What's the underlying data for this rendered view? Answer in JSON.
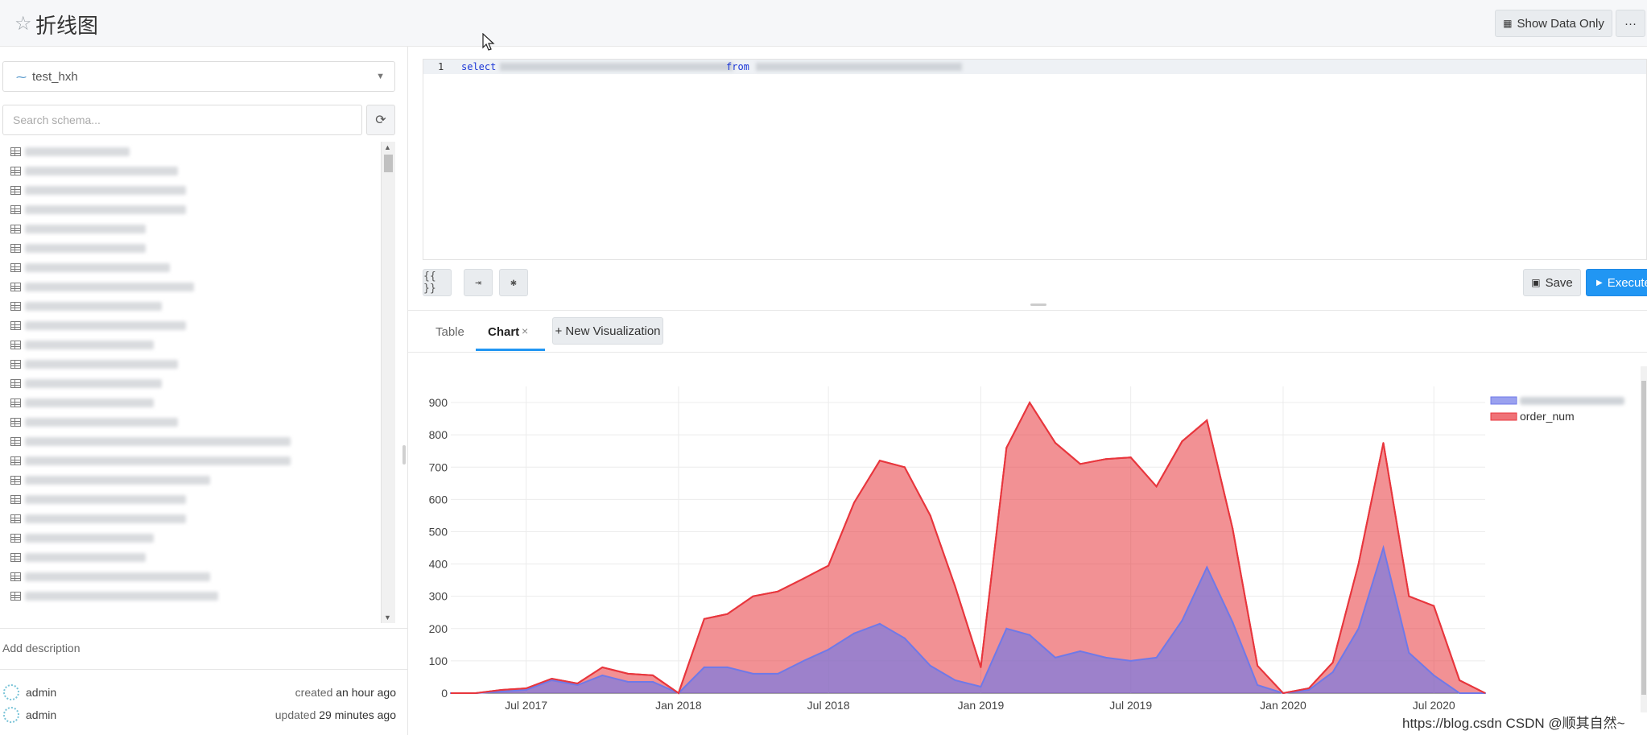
{
  "header": {
    "title": "折线图",
    "show_data_only": "Show Data Only",
    "more": "···"
  },
  "left": {
    "datasource": "test_hxh",
    "search_placeholder": "Search schema...",
    "table_count": 25,
    "add_description": "Add description",
    "created": {
      "user": "admin",
      "prefix": "created",
      "when": "an hour ago"
    },
    "updated": {
      "user": "admin",
      "prefix": "updated",
      "when": "29 minutes ago"
    }
  },
  "editor": {
    "line_number": "1",
    "kw_select": "select",
    "kw_from": "from"
  },
  "toolbar": {
    "format_label": "{{ }}",
    "save": "Save",
    "execute": "Execute"
  },
  "tabs": {
    "table": "Table",
    "chart": "Chart",
    "close": "×",
    "new_viz": "+ New Visualization"
  },
  "watermark": "https://blog.csdn CSDN @顺其自然~",
  "colors": {
    "primary": "#2196f3",
    "series_red": "#e8363d",
    "series_blue": "#6f79e8"
  },
  "chart_data": {
    "type": "area",
    "x": [
      "2017-04",
      "2017-05",
      "2017-06",
      "2017-07",
      "2017-08",
      "2017-09",
      "2017-10",
      "2017-11",
      "2017-12",
      "2018-01",
      "2018-02",
      "2018-03",
      "2018-04",
      "2018-05",
      "2018-06",
      "2018-07",
      "2018-08",
      "2018-09",
      "2018-10",
      "2018-11",
      "2018-12",
      "2019-01",
      "2019-02",
      "2019-03",
      "2019-04",
      "2019-05",
      "2019-06",
      "2019-07",
      "2019-08",
      "2019-09",
      "2019-10",
      "2019-11",
      "2019-12",
      "2020-01",
      "2020-02",
      "2020-03",
      "2020-04",
      "2020-05",
      "2020-06",
      "2020-07",
      "2020-08",
      "2020-09"
    ],
    "x_ticks": [
      "Jul 2017",
      "Jan 2018",
      "Jul 2018",
      "Jan 2019",
      "Jul 2019",
      "Jan 2020",
      "Jul 2020"
    ],
    "ylim": [
      0,
      950
    ],
    "y_ticks": [
      0,
      100,
      200,
      300,
      400,
      500,
      600,
      700,
      800,
      900
    ],
    "grid": true,
    "legend_position": "top-right",
    "series": [
      {
        "name": "",
        "color": "#6f79e8",
        "values": [
          0,
          0,
          5,
          10,
          40,
          25,
          55,
          35,
          35,
          0,
          80,
          80,
          60,
          60,
          100,
          135,
          185,
          215,
          170,
          85,
          40,
          20,
          200,
          180,
          110,
          130,
          110,
          100,
          110,
          225,
          390,
          220,
          25,
          0,
          10,
          65,
          200,
          450,
          125,
          55,
          0,
          0
        ]
      },
      {
        "name": "order_num",
        "color": "#e8363d",
        "values": [
          0,
          0,
          10,
          15,
          45,
          30,
          80,
          60,
          55,
          0,
          230,
          245,
          300,
          315,
          355,
          395,
          590,
          720,
          700,
          550,
          330,
          80,
          760,
          900,
          775,
          710,
          725,
          730,
          640,
          780,
          845,
          510,
          85,
          0,
          15,
          95,
          400,
          775,
          300,
          270,
          40,
          0
        ]
      }
    ]
  }
}
